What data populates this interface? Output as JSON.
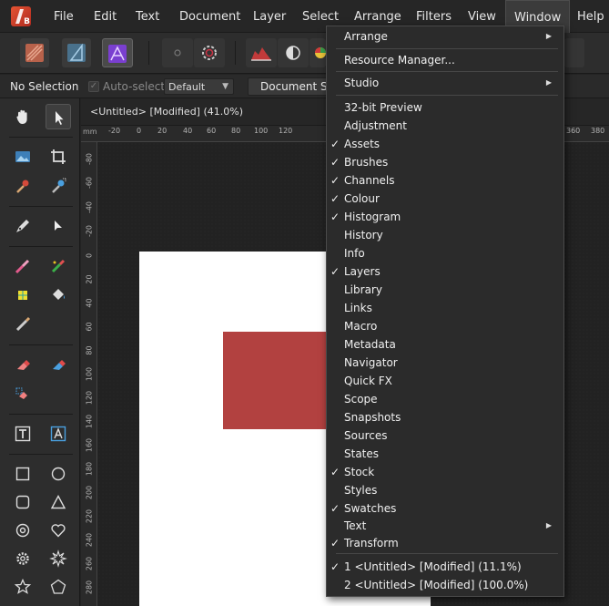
{
  "menubar": {
    "items": [
      "File",
      "Edit",
      "Text",
      "Document",
      "Layer",
      "Select",
      "Arrange",
      "Filters",
      "View",
      "Window",
      "Help"
    ],
    "active": "Window"
  },
  "toolbar": {
    "personas": [
      "pixel-persona-icon",
      "designer-persona-icon",
      "photo-persona-icon"
    ],
    "tools": [
      "circle-icon",
      "gear-icon",
      "histogram-icon",
      "contrast-icon",
      "color-wheel-icon"
    ]
  },
  "context_bar": {
    "selection_label": "No Selection",
    "autoselect_label": "Auto-select:",
    "autoselect_value": "Default",
    "document_setup_label": "Document Se"
  },
  "document": {
    "tab_title": "<Untitled> [Modified] (41.0%)",
    "ruler_unit": "mm",
    "hruler_labels": [
      "-20",
      "0",
      "20",
      "40",
      "60",
      "80",
      "100",
      "120",
      "340",
      "360",
      "380"
    ],
    "vruler_labels": [
      "-80",
      "-60",
      "-40",
      "-20",
      "0",
      "20",
      "40",
      "60",
      "80",
      "100",
      "120",
      "140",
      "160",
      "180",
      "200",
      "220",
      "240",
      "260",
      "280"
    ],
    "accent_shape_color": "#b24140"
  },
  "window_menu": {
    "items": [
      {
        "label": "Arrange",
        "checked": false,
        "submenu": true
      },
      {
        "label": "Resource Manager...",
        "checked": false,
        "submenu": false
      },
      {
        "label": "Studio",
        "checked": false,
        "submenu": true
      },
      {
        "label": "32-bit Preview",
        "checked": false,
        "submenu": false
      },
      {
        "label": "Adjustment",
        "checked": false,
        "submenu": false
      },
      {
        "label": "Assets",
        "checked": true,
        "submenu": false
      },
      {
        "label": "Brushes",
        "checked": true,
        "submenu": false
      },
      {
        "label": "Channels",
        "checked": true,
        "submenu": false
      },
      {
        "label": "Colour",
        "checked": true,
        "submenu": false
      },
      {
        "label": "Histogram",
        "checked": true,
        "submenu": false
      },
      {
        "label": "History",
        "checked": false,
        "submenu": false
      },
      {
        "label": "Info",
        "checked": false,
        "submenu": false
      },
      {
        "label": "Layers",
        "checked": true,
        "submenu": false
      },
      {
        "label": "Library",
        "checked": false,
        "submenu": false
      },
      {
        "label": "Links",
        "checked": false,
        "submenu": false
      },
      {
        "label": "Macro",
        "checked": false,
        "submenu": false
      },
      {
        "label": "Metadata",
        "checked": false,
        "submenu": false
      },
      {
        "label": "Navigator",
        "checked": false,
        "submenu": false
      },
      {
        "label": "Quick FX",
        "checked": false,
        "submenu": false
      },
      {
        "label": "Scope",
        "checked": false,
        "submenu": false
      },
      {
        "label": "Snapshots",
        "checked": false,
        "submenu": false
      },
      {
        "label": "Sources",
        "checked": false,
        "submenu": false
      },
      {
        "label": "States",
        "checked": false,
        "submenu": false
      },
      {
        "label": "Stock",
        "checked": true,
        "submenu": false
      },
      {
        "label": "Styles",
        "checked": false,
        "submenu": false
      },
      {
        "label": "Swatches",
        "checked": true,
        "submenu": false
      },
      {
        "label": "Text",
        "checked": false,
        "submenu": true
      },
      {
        "label": "Transform",
        "checked": true,
        "submenu": false
      },
      {
        "label": "1 <Untitled> [Modified] (11.1%)",
        "checked": true,
        "submenu": false
      },
      {
        "label": "2 <Untitled> [Modified] (100.0%)",
        "checked": false,
        "submenu": false
      }
    ],
    "check_glyph": "✓",
    "arrow_glyph": "▶"
  }
}
